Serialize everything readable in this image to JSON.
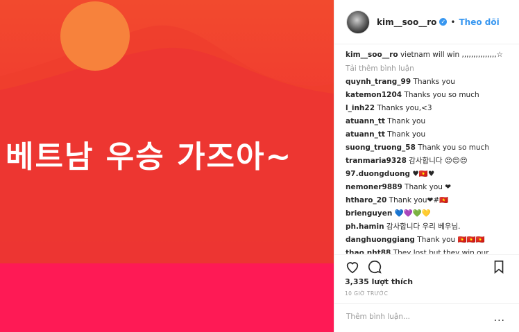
{
  "post": {
    "overlay_text": "베트남 우승 가즈아~"
  },
  "header": {
    "username": "kim__soo__ro",
    "verified_icon": "verified-badge-icon",
    "separator": "•",
    "follow_label": "Theo dõi"
  },
  "caption": {
    "user": "kim__soo__ro",
    "text": "vietnam will win ,,,,,,,,,,,,,,,☆"
  },
  "load_more_label": "Tải thêm bình luận",
  "comments": [
    {
      "user": "quynh_trang_99",
      "text": "Thanks you"
    },
    {
      "user": "katemon1204",
      "text": "Thanks you so much"
    },
    {
      "user": "l_inh22",
      "text": "Thanks you,<3"
    },
    {
      "user": "atuann_tt",
      "text": "Thank you"
    },
    {
      "user": "atuann_tt",
      "text": "Thank you"
    },
    {
      "user": "suong_truong_58",
      "text": "Thank you so much"
    },
    {
      "user": "tranmaria9328",
      "text": "감사합니다 😍😍😍"
    },
    {
      "user": "97.duongduong",
      "text": "♥🇻🇳♥"
    },
    {
      "user": "nemoner9889",
      "text": "Thank you ❤"
    },
    {
      "user": "htharo_20",
      "text": "Thank you❤#🇻🇳"
    },
    {
      "user": "brienguyen",
      "text": "💙💜💚💛"
    },
    {
      "user": "ph.hamin",
      "text": "감사합니다 우리 베우님."
    },
    {
      "user": "danghuonggiang",
      "text": "Thank you 🇻🇳🇻🇳🇻🇳"
    },
    {
      "user": "thao.nht88",
      "text": "They lost but they win our"
    }
  ],
  "actions": {
    "like_icon": "heart-icon",
    "comment_icon": "comment-icon",
    "save_icon": "bookmark-icon"
  },
  "likes_text": "3,335 lượt thích",
  "time_text": "10 GIỜ TRƯỚC",
  "add_comment": {
    "placeholder": "Thêm bình luận...",
    "more_label": "..."
  }
}
